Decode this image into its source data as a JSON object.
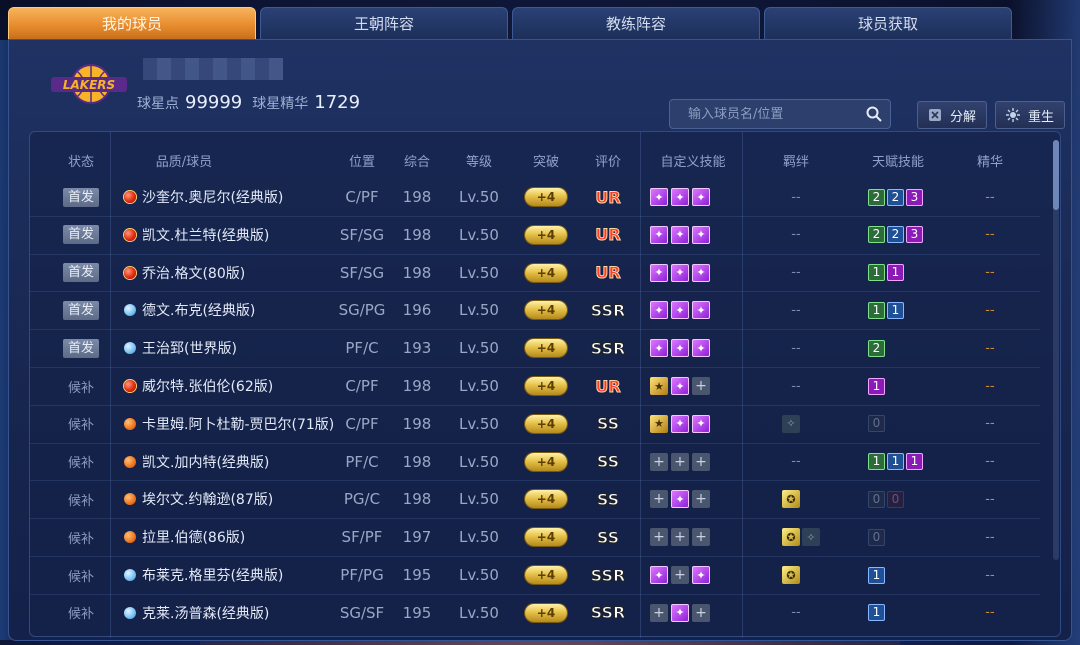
{
  "tabs": [
    {
      "label": "我的球员",
      "active": true
    },
    {
      "label": "王朝阵容",
      "active": false
    },
    {
      "label": "教练阵容",
      "active": false
    },
    {
      "label": "球员获取",
      "active": false
    }
  ],
  "team": {
    "logo_text": "LAKERS",
    "star_points_label": "球星点",
    "star_points": "99999",
    "essence_label": "球星精华",
    "essence": "1729"
  },
  "search": {
    "placeholder": "输入球员名/位置",
    "icon": "search-icon"
  },
  "buttons": {
    "decompose": "分解",
    "reborn": "重生"
  },
  "columns": [
    "状态",
    "品质/球员",
    "位置",
    "综合",
    "等级",
    "突破",
    "评价",
    "自定义技能",
    "羁绊",
    "天赋技能",
    "精华"
  ],
  "colors": {
    "accent": "#e58a2c",
    "panel": "#1f3263",
    "ur": "#ff3b2a"
  },
  "players": [
    {
      "state": "首发",
      "starter": true,
      "quality": "red",
      "name": "沙奎尔.奥尼尔(经典版)",
      "pos": "C/PF",
      "ovr": "198",
      "lv": "Lv.50",
      "brk": "+4",
      "rate": "UR",
      "skills": [
        "purple",
        "purple",
        "purple"
      ],
      "bond": "--",
      "bond_icons": [],
      "talents": [
        {
          "v": "2",
          "c": "g"
        },
        {
          "v": "2",
          "c": "b"
        },
        {
          "v": "3",
          "c": "p"
        }
      ],
      "ess": "--"
    },
    {
      "state": "首发",
      "starter": true,
      "quality": "red",
      "name": "凯文.杜兰特(经典版)",
      "pos": "SF/SG",
      "ovr": "198",
      "lv": "Lv.50",
      "brk": "+4",
      "rate": "UR",
      "skills": [
        "purple",
        "purple",
        "purple"
      ],
      "bond": "--",
      "bond_icons": [],
      "talents": [
        {
          "v": "2",
          "c": "g"
        },
        {
          "v": "2",
          "c": "b"
        },
        {
          "v": "3",
          "c": "p"
        }
      ],
      "ess": "--"
    },
    {
      "state": "首发",
      "starter": true,
      "quality": "red",
      "name": "乔治.格文(80版)",
      "pos": "SF/SG",
      "ovr": "198",
      "lv": "Lv.50",
      "brk": "+4",
      "rate": "UR",
      "skills": [
        "purple",
        "purple",
        "purple"
      ],
      "bond": "--",
      "bond_icons": [],
      "talents": [
        {
          "v": "1",
          "c": "g"
        },
        {
          "v": "1",
          "c": "p"
        }
      ],
      "ess": "--"
    },
    {
      "state": "首发",
      "starter": true,
      "quality": "blue",
      "name": "德文.布克(经典版)",
      "pos": "SG/PG",
      "ovr": "196",
      "lv": "Lv.50",
      "brk": "+4",
      "rate": "SSR",
      "skills": [
        "purple",
        "purple",
        "purple"
      ],
      "bond": "--",
      "bond_icons": [],
      "talents": [
        {
          "v": "1",
          "c": "g"
        },
        {
          "v": "1",
          "c": "b"
        }
      ],
      "ess": "--"
    },
    {
      "state": "首发",
      "starter": true,
      "quality": "blue",
      "name": "王治郅(世界版)",
      "pos": "PF/C",
      "ovr": "193",
      "lv": "Lv.50",
      "brk": "+4",
      "rate": "SSR",
      "skills": [
        "purple",
        "purple",
        "purple"
      ],
      "bond": "--",
      "bond_icons": [],
      "talents": [
        {
          "v": "2",
          "c": "g"
        }
      ],
      "ess": "--"
    },
    {
      "state": "候补",
      "starter": false,
      "quality": "red",
      "name": "威尔特.张伯伦(62版)",
      "pos": "C/PF",
      "ovr": "198",
      "lv": "Lv.50",
      "brk": "+4",
      "rate": "UR",
      "skills": [
        "gold",
        "purple",
        "empty"
      ],
      "bond": "--",
      "bond_icons": [],
      "talents": [
        {
          "v": "1",
          "c": "p"
        }
      ],
      "ess": "--"
    },
    {
      "state": "候补",
      "starter": false,
      "quality": "orange",
      "name": "卡里姆.阿卜杜勒-贾巴尔(71版)",
      "pos": "C/PF",
      "ovr": "198",
      "lv": "Lv.50",
      "brk": "+4",
      "rate": "SS",
      "skills": [
        "gold",
        "purple",
        "purple"
      ],
      "bond": "",
      "bond_icons": [
        "grey"
      ],
      "talents": [
        {
          "v": "0",
          "c": "d"
        }
      ],
      "ess": "--"
    },
    {
      "state": "候补",
      "starter": false,
      "quality": "orange",
      "name": "凯文.加内特(经典版)",
      "pos": "PF/C",
      "ovr": "198",
      "lv": "Lv.50",
      "brk": "+4",
      "rate": "SS",
      "skills": [
        "empty",
        "empty",
        "empty"
      ],
      "bond": "--",
      "bond_icons": [],
      "talents": [
        {
          "v": "1",
          "c": "g"
        },
        {
          "v": "1",
          "c": "b"
        },
        {
          "v": "1",
          "c": "p"
        }
      ],
      "ess": "--"
    },
    {
      "state": "候补",
      "starter": false,
      "quality": "orange",
      "name": "埃尔文.约翰逊(87版)",
      "pos": "PG/C",
      "ovr": "198",
      "lv": "Lv.50",
      "brk": "+4",
      "rate": "SS",
      "skills": [
        "empty",
        "purple",
        "empty"
      ],
      "bond": "",
      "bond_icons": [
        "gold"
      ],
      "talents": [
        {
          "v": "0",
          "c": "d"
        },
        {
          "v": "0",
          "c": "dp"
        }
      ],
      "ess": "--"
    },
    {
      "state": "候补",
      "starter": false,
      "quality": "orange",
      "name": "拉里.伯德(86版)",
      "pos": "SF/PF",
      "ovr": "197",
      "lv": "Lv.50",
      "brk": "+4",
      "rate": "SS",
      "skills": [
        "empty",
        "empty",
        "empty"
      ],
      "bond": "",
      "bond_icons": [
        "gold",
        "grey"
      ],
      "talents": [
        {
          "v": "0",
          "c": "d"
        }
      ],
      "ess": "--"
    },
    {
      "state": "候补",
      "starter": false,
      "quality": "blue",
      "name": "布莱克.格里芬(经典版)",
      "pos": "PF/PG",
      "ovr": "195",
      "lv": "Lv.50",
      "brk": "+4",
      "rate": "SSR",
      "skills": [
        "purple",
        "empty",
        "purple"
      ],
      "bond": "",
      "bond_icons": [
        "gold"
      ],
      "talents": [
        {
          "v": "1",
          "c": "b"
        }
      ],
      "ess": "--"
    },
    {
      "state": "候补",
      "starter": false,
      "quality": "blue",
      "name": "克莱.汤普森(经典版)",
      "pos": "SG/SF",
      "ovr": "195",
      "lv": "Lv.50",
      "brk": "+4",
      "rate": "SSR",
      "skills": [
        "empty",
        "purple",
        "empty"
      ],
      "bond": "--",
      "bond_icons": [],
      "talents": [
        {
          "v": "1",
          "c": "b"
        }
      ],
      "ess": "--"
    }
  ]
}
